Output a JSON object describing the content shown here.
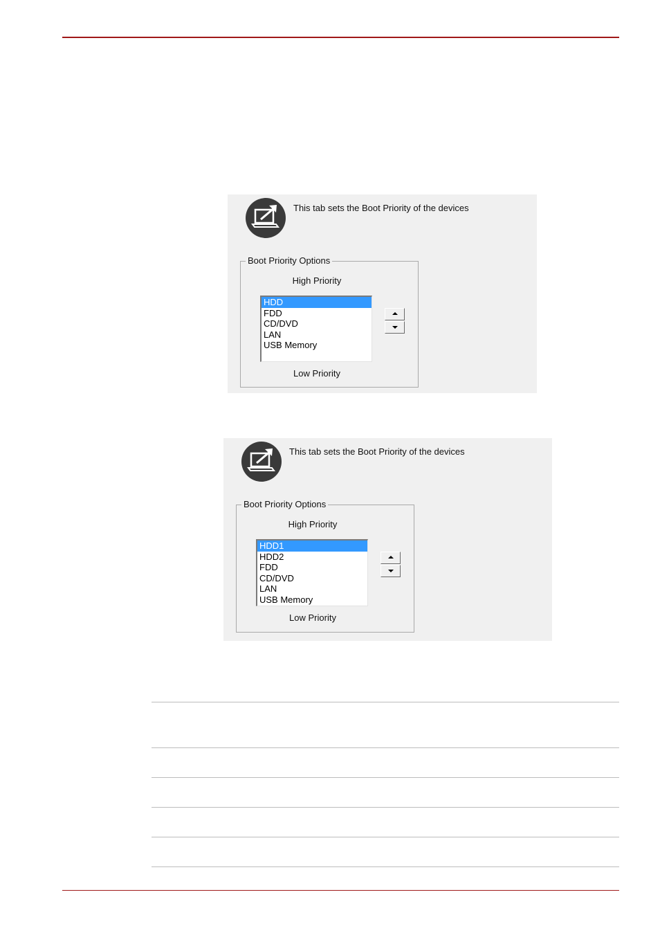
{
  "dialogs": [
    {
      "description": "This tab sets the Boot Priority of the devices",
      "group_title": "Boot Priority Options",
      "high_label": "High Priority",
      "low_label": "Low Priority",
      "items": [
        "HDD",
        "FDD",
        "CD/DVD",
        "LAN",
        "USB Memory"
      ],
      "selected": "HDD",
      "icon": "laptop-arrow-icon"
    },
    {
      "description": "This tab sets the Boot Priority of the devices",
      "group_title": "Boot Priority Options",
      "high_label": "High Priority",
      "low_label": "Low Priority",
      "items": [
        "HDD1",
        "HDD2",
        "FDD",
        "CD/DVD",
        "LAN",
        "USB Memory"
      ],
      "selected": "HDD1",
      "icon": "laptop-arrow-icon"
    }
  ],
  "colors": {
    "header_rule": "#a01818",
    "selection": "#3399ff",
    "panel_background": "#f0f0f0"
  }
}
